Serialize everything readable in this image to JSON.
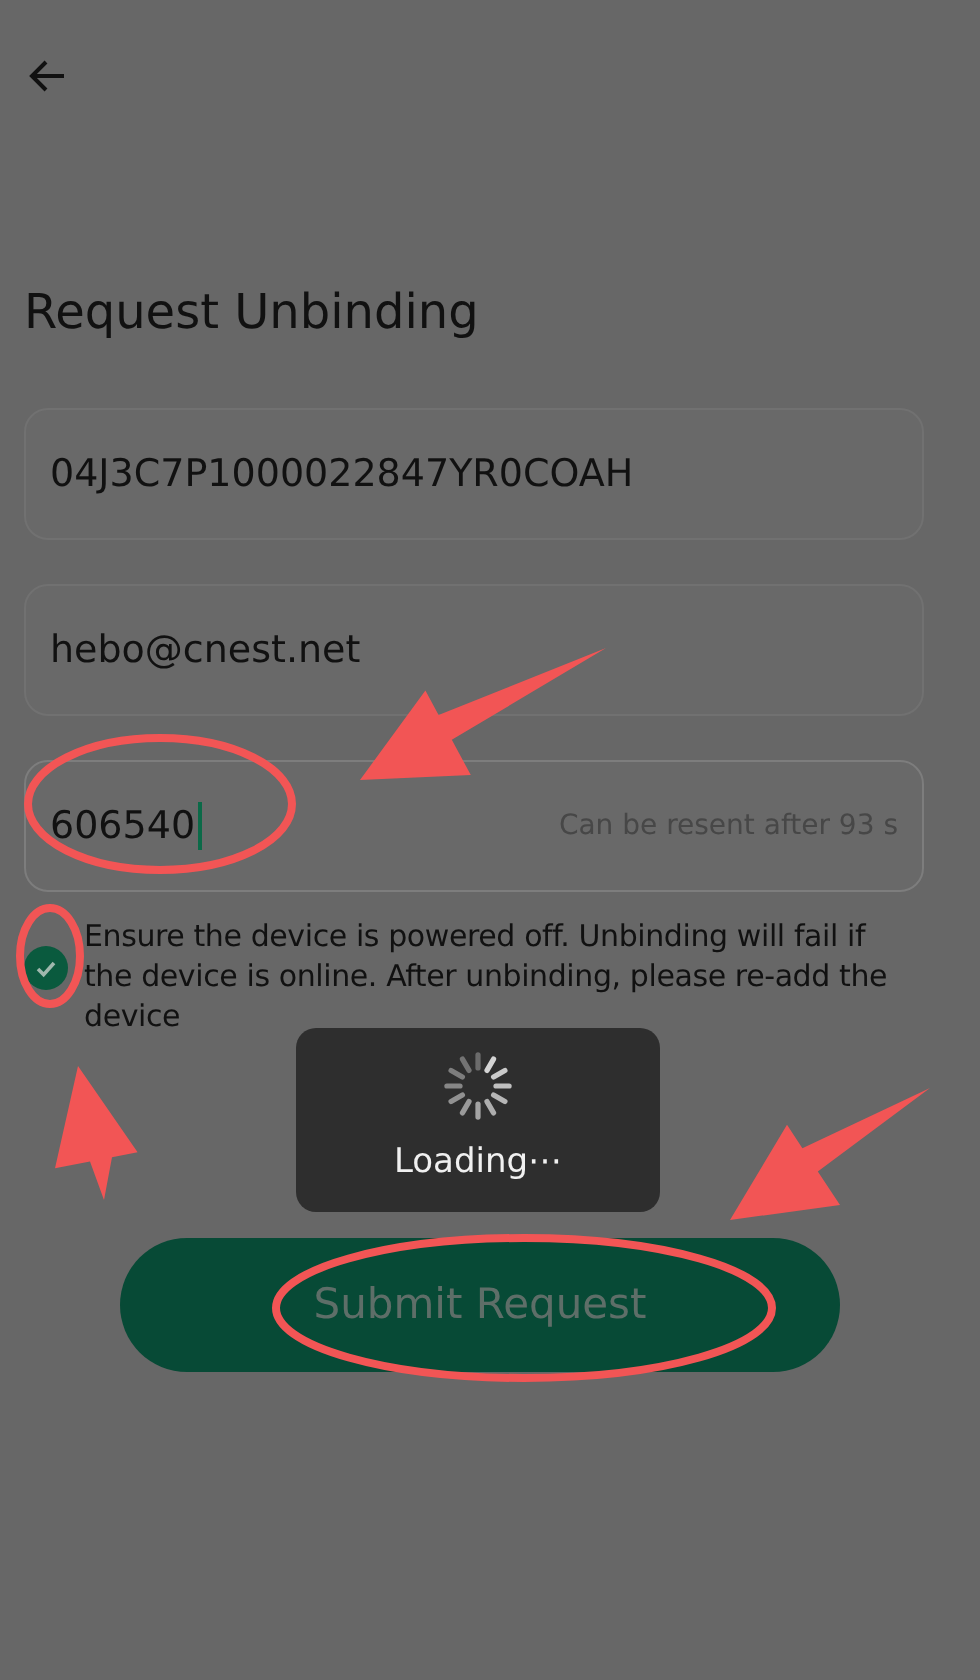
{
  "title": "Request Unbinding",
  "fields": [
    {
      "value": "04J3C7P1000022847YR0COAH",
      "focused": false
    },
    {
      "value": "hebo@cnest.net",
      "focused": false
    },
    {
      "value": "606540",
      "hint": "Can be resent after 93 s",
      "focused": true
    }
  ],
  "agreement": {
    "checked": true,
    "text": "Ensure the device is powered off. Unbinding will fail if the device is online. After unbinding, please re-add the device"
  },
  "loading": {
    "text": "Loading⋯"
  },
  "submit_button": {
    "label": "Submit Request",
    "disabled": true
  }
}
